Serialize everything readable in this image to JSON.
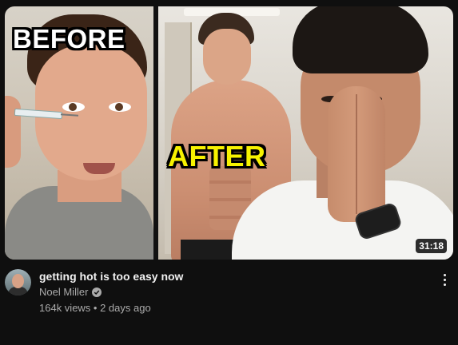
{
  "video": {
    "title": "getting hot is too easy now",
    "channel": "Noel Miller",
    "views": "164k views",
    "separator": " • ",
    "age": "2 days ago",
    "duration": "31:18",
    "thumbnail_text_left": "BEFORE",
    "thumbnail_text_right": "AFTER",
    "channel_verified": true
  },
  "icons": {
    "verified": "verified-check-icon",
    "more": "more-vertical-icon"
  },
  "colors": {
    "background": "#0f0f0f",
    "title_text": "#f1f1f1",
    "secondary_text": "#aaaaaa",
    "after_label": "#f7f200"
  }
}
